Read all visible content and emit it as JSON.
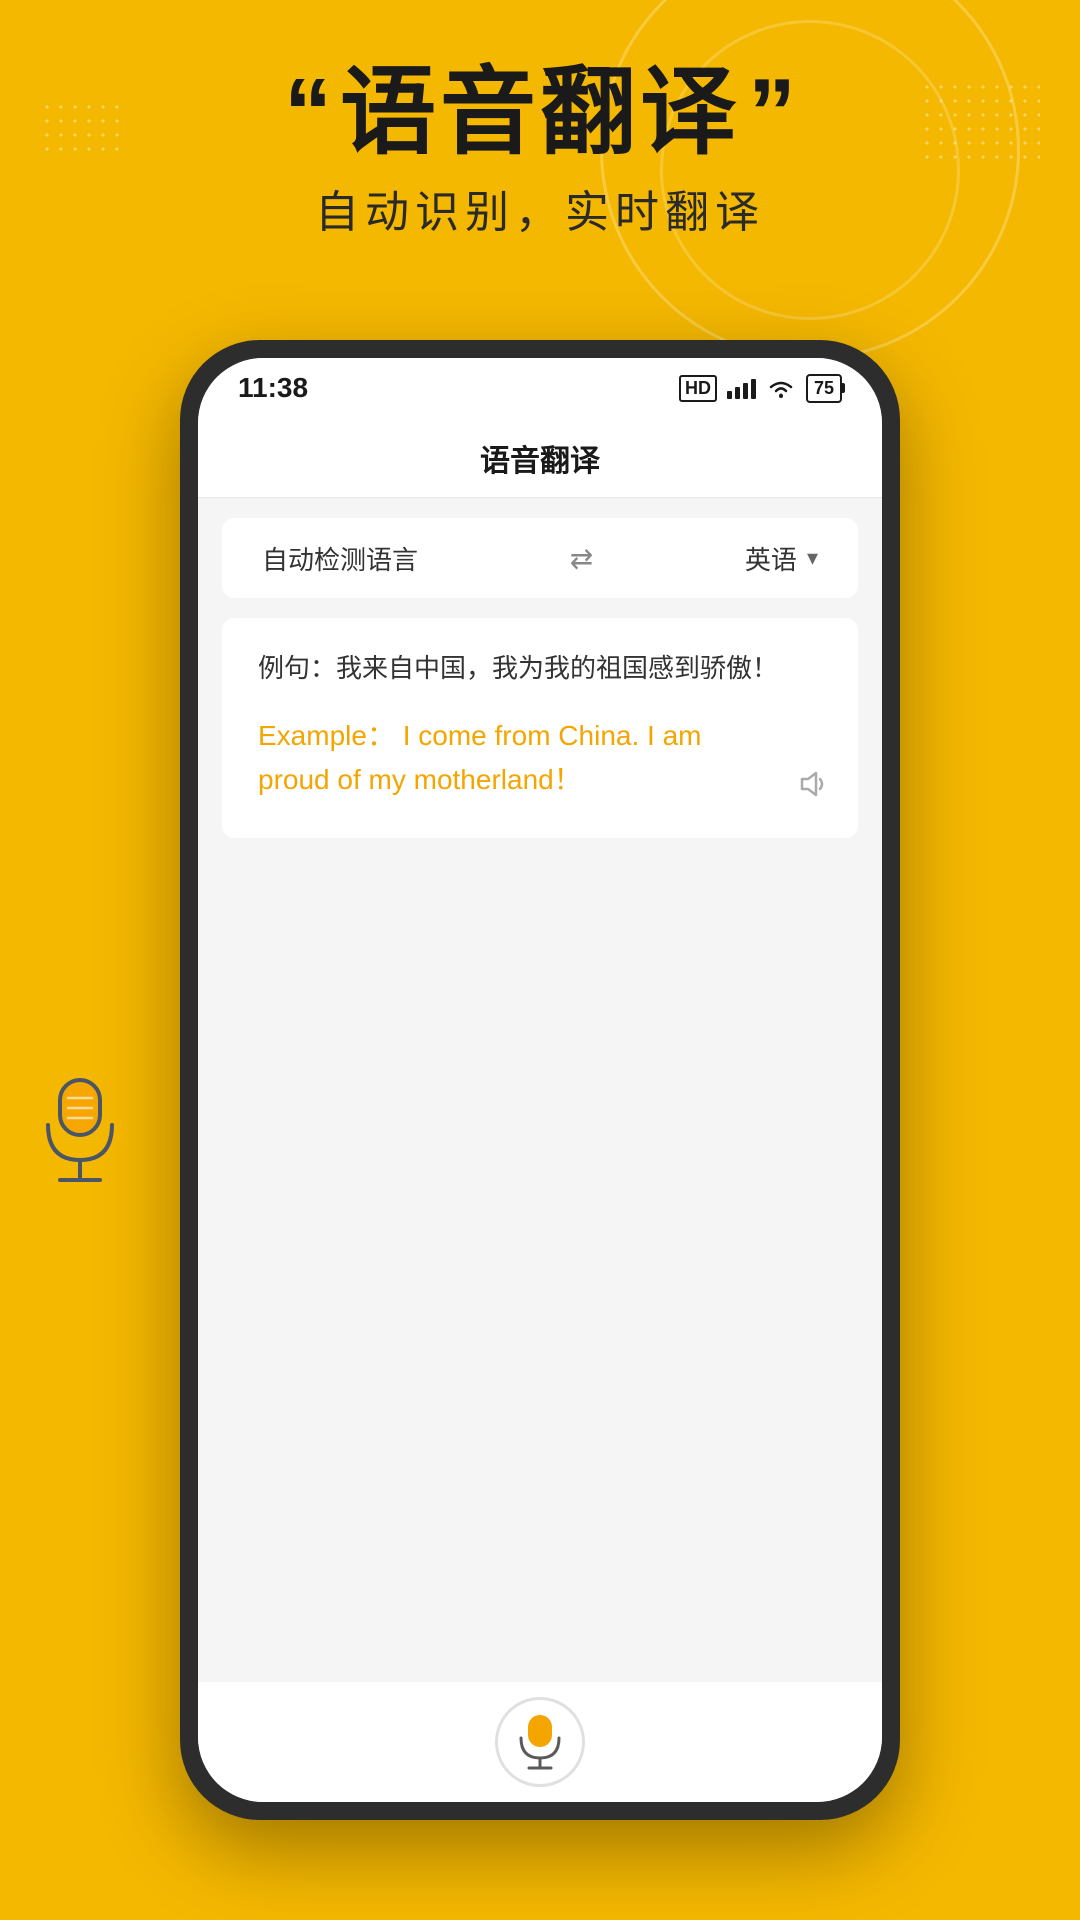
{
  "background": {
    "color": "#F5B800"
  },
  "header": {
    "quote_left": "“",
    "title": "语音翻译",
    "quote_right": "”",
    "subtitle": "自动识别，实时翻译"
  },
  "statusBar": {
    "time": "11:38",
    "hd_label": "HD",
    "battery_level": "75"
  },
  "appTitle": "语音翻译",
  "langBar": {
    "source": "自动检测语言",
    "swap_icon": "⇄",
    "target": "英语",
    "dropdown_icon": "▾"
  },
  "translationCard": {
    "sourceText": "例句：我来自中国，我为我的祖国感到骄傲！",
    "translatedText": "Example： I come from China. I am proud of my motherland！"
  },
  "bottomMic": {
    "label": "mic-button"
  }
}
